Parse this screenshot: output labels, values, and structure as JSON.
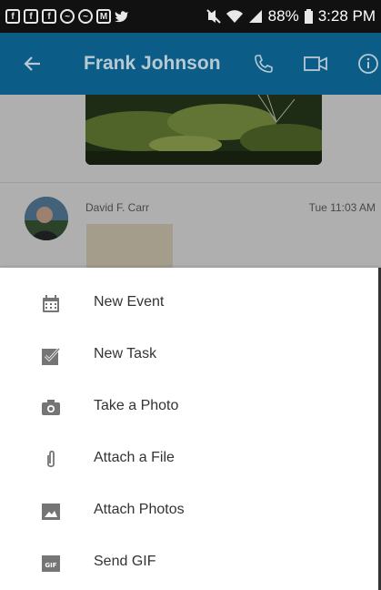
{
  "status_bar": {
    "battery": "88%",
    "time": "3:28 PM"
  },
  "app_bar": {
    "title": "Frank Johnson",
    "icons": [
      "back-arrow-icon",
      "phone-icon",
      "video-call-icon",
      "info-icon"
    ]
  },
  "conversation": {
    "message": {
      "sender": "David F. Carr",
      "time": "Tue 11:03 AM"
    }
  },
  "menu": {
    "items": [
      {
        "label": "New Event",
        "icon": "calendar-icon"
      },
      {
        "label": "New Task",
        "icon": "task-check-icon"
      },
      {
        "label": "Take a Photo",
        "icon": "camera-icon"
      },
      {
        "label": "Attach a File",
        "icon": "paperclip-icon"
      },
      {
        "label": "Attach Photos",
        "icon": "image-icon"
      },
      {
        "label": "Send GIF",
        "icon": "gif-icon"
      }
    ]
  },
  "colors": {
    "app_bar": "#0b5c87",
    "status_bar": "#111111",
    "icon_gray": "#757575"
  }
}
